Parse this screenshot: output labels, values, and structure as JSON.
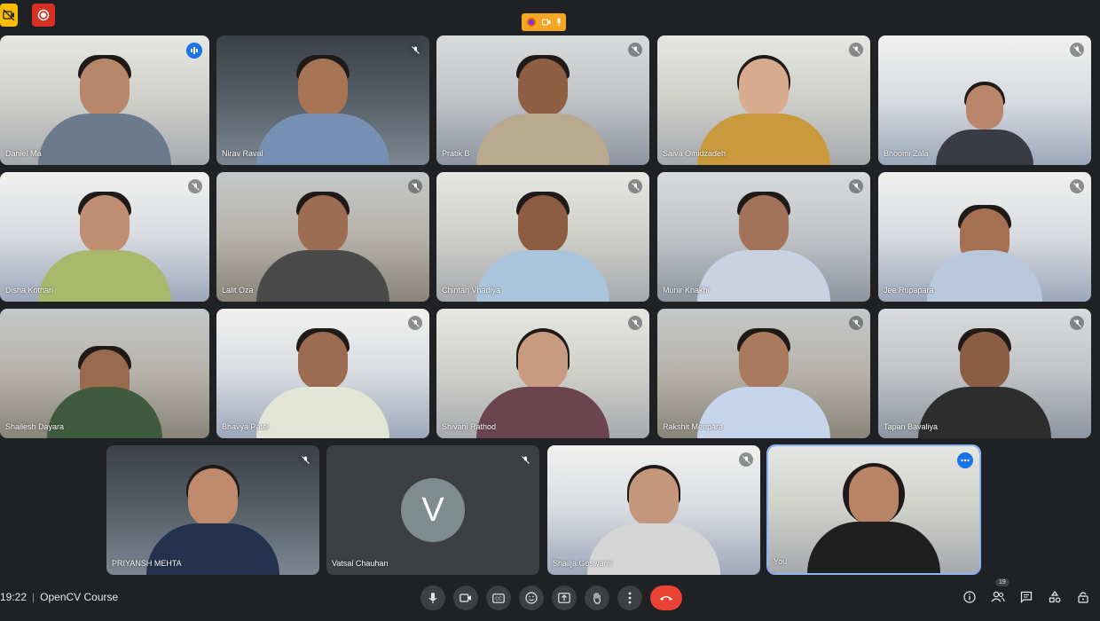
{
  "meeting": {
    "time": "19:22",
    "separator": "|",
    "title": "OpenCV Course"
  },
  "participant_count": "19",
  "tiles": [
    {
      "name": "Daniel Ma",
      "state": "speaking"
    },
    {
      "name": "Nirav Raval",
      "state": "muted"
    },
    {
      "name": "Pratik B",
      "state": "muted"
    },
    {
      "name": "Saiva Omidzadeh",
      "state": "muted"
    },
    {
      "name": "Bhoomi Zala",
      "state": "muted"
    },
    {
      "name": "Disha Kothari",
      "state": "muted"
    },
    {
      "name": "Lalit Oza",
      "state": "muted"
    },
    {
      "name": "Chintan Vhadiya",
      "state": "muted"
    },
    {
      "name": "Munir Khakhi",
      "state": "muted"
    },
    {
      "name": "Jee Rupapara",
      "state": "muted"
    },
    {
      "name": "Shailesh Dayara",
      "state": "none"
    },
    {
      "name": "Bhavya Patel",
      "state": "muted"
    },
    {
      "name": "Shivani Rathod",
      "state": "muted"
    },
    {
      "name": "Rakshit Menpara",
      "state": "muted"
    },
    {
      "name": "Tapan Bavaliya",
      "state": "muted"
    },
    {
      "name": "PRIYANSH MEHTA",
      "state": "muted"
    },
    {
      "name": "Vatsal Chauhan",
      "state": "muted",
      "avatar_letter": "V"
    },
    {
      "name": "Shailja Goswami",
      "state": "muted"
    },
    {
      "name": "You",
      "state": "self"
    }
  ],
  "controls": [
    "mic-icon",
    "camera-icon",
    "captions-icon",
    "emoji-icon",
    "present-icon",
    "raise-hand-icon",
    "more-options-icon",
    "end-call-icon"
  ],
  "right_icons": [
    "info-icon",
    "people-icon",
    "chat-icon",
    "activities-icon",
    "host-controls-icon"
  ],
  "colors": {
    "background": "#202124",
    "end_call": "#ea4335",
    "record": "#d93025",
    "active_border": "#8ab4f8",
    "accent": "#1a73e8"
  }
}
